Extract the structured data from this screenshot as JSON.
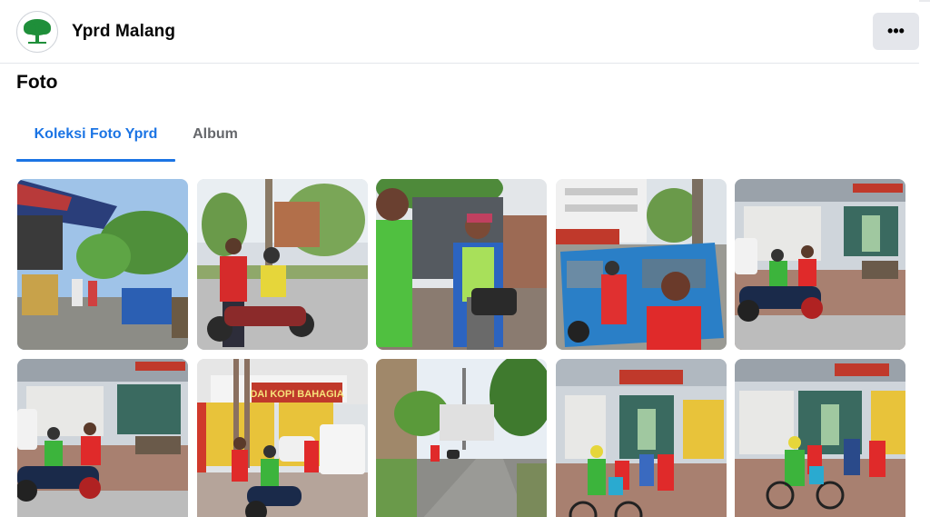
{
  "header": {
    "page_name": "Yprd Malang",
    "avatar_icon": "tree-logo-icon",
    "more_label": "•••"
  },
  "section": {
    "title": "Foto"
  },
  "tabs": [
    {
      "label": "Koleksi Foto Yprd",
      "active": true
    },
    {
      "label": "Album",
      "active": false
    }
  ],
  "photos": [
    {
      "scene": "market-stall"
    },
    {
      "scene": "motorbike-handover"
    },
    {
      "scene": "street-handover"
    },
    {
      "scene": "blue-minibus"
    },
    {
      "scene": "shopfront-motorbike"
    },
    {
      "scene": "shopfront-motorbike-2"
    },
    {
      "scene": "kopi-bahagia"
    },
    {
      "scene": "road-palms"
    },
    {
      "scene": "shopfront-bicycle"
    },
    {
      "scene": "shopfront-bicycle-2"
    }
  ],
  "shop_signs": {
    "kopi": "DAI KOPI BAHAGIA"
  },
  "colors": {
    "accent": "#1b74e4",
    "logo_green": "#1f8f3a",
    "volunteer_red": "#e0262c",
    "rider_green": "#3cb43c"
  }
}
